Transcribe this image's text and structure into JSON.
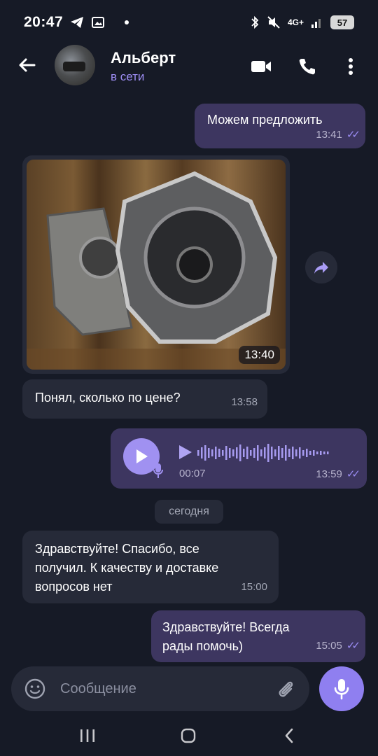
{
  "status_bar": {
    "time": "20:47",
    "network": "4G+",
    "battery": "57",
    "icons": [
      "telegram-icon",
      "gallery-icon",
      "bluetooth-icon",
      "mute-icon",
      "signal-icon"
    ]
  },
  "header": {
    "contact_name": "Альберт",
    "contact_status": "в сети",
    "icons": [
      "back-arrow-icon",
      "video-call-icon",
      "phone-icon",
      "more-vert-icon"
    ]
  },
  "messages": [
    {
      "direction": "out",
      "type": "text",
      "text": "Можем предложить",
      "time": "13:41",
      "read": true
    },
    {
      "direction": "in",
      "type": "photo",
      "time": "13:40",
      "description_icon": "gearbox-photo"
    },
    {
      "direction": "in",
      "type": "text",
      "text": "Понял, сколько по цене?",
      "time": "13:58"
    },
    {
      "direction": "out",
      "type": "voice",
      "duration": "00:07",
      "time": "13:59",
      "read": true
    },
    {
      "direction": "in",
      "type": "text",
      "text": "Здравствуйте! Спасибо, все получил. К качеству и доставке вопросов нет",
      "time": "15:00"
    },
    {
      "direction": "out",
      "type": "text",
      "text": "Здравствуйте! Всегда рады помочь)",
      "time": "15:05",
      "read": true
    }
  ],
  "date_separator": "сегодня",
  "composer": {
    "placeholder": "Сообщение",
    "icons": [
      "emoji-icon",
      "attach-icon",
      "microphone-icon"
    ]
  },
  "colors": {
    "background": "#161a26",
    "bubble_out": "#3d3660",
    "bubble_in": "#262a38",
    "accent": "#8f7ff0"
  }
}
